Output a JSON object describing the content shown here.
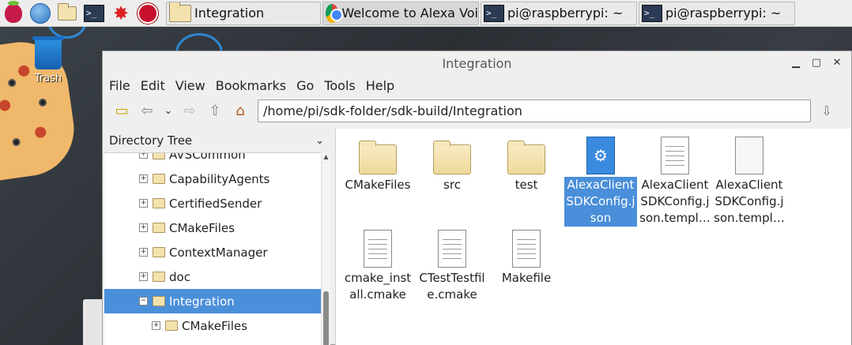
{
  "taskbar": {
    "buttons": [
      {
        "label": "Integration"
      },
      {
        "label": "Welcome to Alexa Voi"
      },
      {
        "label": "pi@raspberrypi: ~"
      },
      {
        "label": "pi@raspberrypi: ~"
      }
    ]
  },
  "desktop": {
    "trash_label": "Trash"
  },
  "window": {
    "title": "Integration",
    "menu": [
      "File",
      "Edit",
      "View",
      "Bookmarks",
      "Go",
      "Tools",
      "Help"
    ],
    "path": "/home/pi/sdk-folder/sdk-build/Integration",
    "sidebar": {
      "heading": "Directory Tree",
      "items": [
        {
          "label": "AVSCommon",
          "expander": "+"
        },
        {
          "label": "CapabilityAgents",
          "expander": "+"
        },
        {
          "label": "CertifiedSender",
          "expander": "+"
        },
        {
          "label": "CMakeFiles",
          "expander": "+"
        },
        {
          "label": "ContextManager",
          "expander": "+"
        },
        {
          "label": "doc",
          "expander": "+"
        },
        {
          "label": "Integration",
          "expander": "−",
          "selected": true
        },
        {
          "label": "CMakeFiles",
          "expander": "+"
        }
      ]
    },
    "files": [
      {
        "name": "CMakeFiles",
        "type": "folder"
      },
      {
        "name": "src",
        "type": "folder"
      },
      {
        "name": "test",
        "type": "folder"
      },
      {
        "name": "AlexaClient SDKConfig.j son",
        "type": "json",
        "selected": true
      },
      {
        "name": "AlexaClient SDKConfig.j son.templ…",
        "type": "text"
      },
      {
        "name": "AlexaClient SDKConfig.j son.templ…",
        "type": "blank"
      },
      {
        "name": "cmake_inst all.cmake",
        "type": "text"
      },
      {
        "name": "CTestTestfil e.cmake",
        "type": "text"
      },
      {
        "name": "Makefile",
        "type": "text"
      }
    ]
  }
}
